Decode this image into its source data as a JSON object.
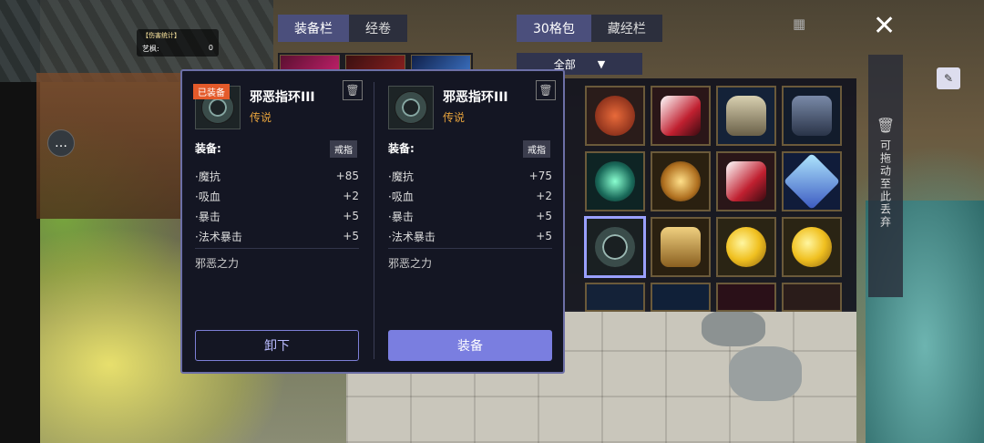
{
  "hud": {
    "stat_title": "【伤害统计】",
    "stat_label": "艺枫:",
    "stat_value": "0",
    "chat_icon": "chat-bubble-icon"
  },
  "inventory": {
    "left_tabs": [
      {
        "label": "装备栏",
        "active": true
      },
      {
        "label": "经卷",
        "active": false
      }
    ],
    "right_tabs": [
      {
        "label": "30格包",
        "active": true
      },
      {
        "label": "藏经栏",
        "active": false
      }
    ],
    "filter": {
      "selected": "全部"
    },
    "discard_zone": "可拖动至此丢弃"
  },
  "compare": {
    "equipped": {
      "tag": "已装备",
      "name": "邪恶指环III",
      "rarity": "传说",
      "equip_label": "装备:",
      "slot": "戒指",
      "stats": [
        {
          "name": "·魔抗",
          "value": "+85"
        },
        {
          "name": "·吸血",
          "value": "+2"
        },
        {
          "name": "·暴击",
          "value": "+5"
        },
        {
          "name": "·法术暴击",
          "value": "+5"
        }
      ],
      "passive": "邪恶之力",
      "action_label": "卸下"
    },
    "candidate": {
      "name": "邪恶指环III",
      "rarity": "传说",
      "equip_label": "装备:",
      "slot": "戒指",
      "stats": [
        {
          "name": "·魔抗",
          "value": "+75"
        },
        {
          "name": "·吸血",
          "value": "+2"
        },
        {
          "name": "·暴击",
          "value": "+5"
        },
        {
          "name": "·法术暴击",
          "value": "+5"
        }
      ],
      "passive": "邪恶之力",
      "action_label": "装备"
    }
  },
  "colors": {
    "accent": "#7a7ee0",
    "rarity_legendary": "#e6a23c",
    "equipped_tag": "#e35a2a"
  }
}
